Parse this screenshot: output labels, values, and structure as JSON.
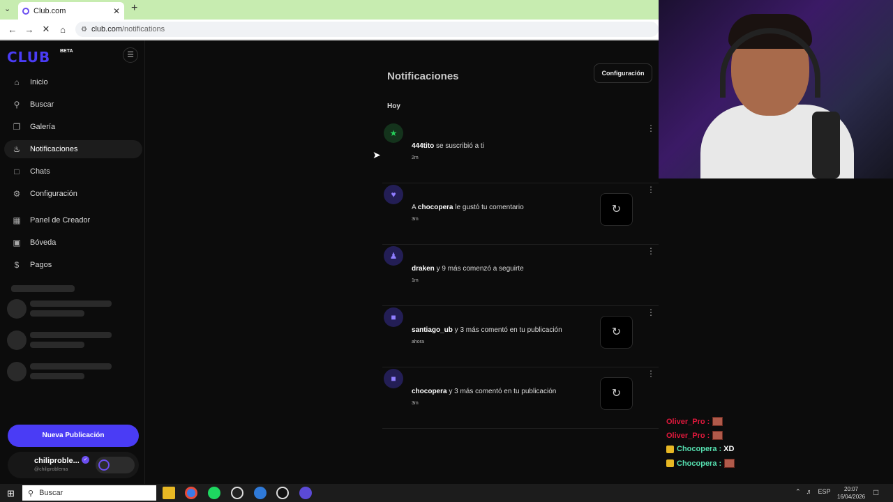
{
  "browser": {
    "tab_title": "Club.com",
    "url_host": "club.com",
    "url_path": "/notifications"
  },
  "sidebar": {
    "logo": "CLUB",
    "beta": "BETA",
    "items": [
      {
        "label": "Inicio",
        "icon": "home-icon"
      },
      {
        "label": "Buscar",
        "icon": "search-icon"
      },
      {
        "label": "Galería",
        "icon": "gallery-icon"
      },
      {
        "label": "Notificaciones",
        "icon": "bell-icon"
      },
      {
        "label": "Chats",
        "icon": "chat-icon"
      },
      {
        "label": "Configuración",
        "icon": "gear-icon"
      },
      {
        "label": "Panel de Creador",
        "icon": "dashboard-icon"
      },
      {
        "label": "Bóveda",
        "icon": "vault-icon"
      },
      {
        "label": "Pagos",
        "icon": "dollar-icon"
      }
    ],
    "new_post": "Nueva Publicación",
    "user_name": "chiliproble...",
    "user_handle": "@chiliproblema"
  },
  "main": {
    "title": "Notificaciones",
    "config_button": "Configuración",
    "section": "Hoy",
    "notifications": [
      {
        "user": "444tito",
        "pre": "",
        "rest": " se suscribió a ti",
        "time": "2m",
        "icon": "star-icon",
        "color": "green"
      },
      {
        "user": "chocopera",
        "pre": "A ",
        "rest": " le gustó tu comentario",
        "time": "3m",
        "icon": "heart-icon",
        "color": "purple"
      },
      {
        "user": "draken",
        "pre": "",
        "rest": " y 9 más comenzó a seguirte",
        "time": "1m",
        "icon": "person-add-icon",
        "color": "purple"
      },
      {
        "user": "santiago_ub",
        "pre": "",
        "rest": " y 3 más comentó en tu publicación",
        "time": "ahora",
        "icon": "comment-icon",
        "color": "purple"
      },
      {
        "user": "chocopera",
        "pre": "",
        "rest": " y 3 más comentó en tu publicación",
        "time": "3m",
        "icon": "comment-icon",
        "color": "purple"
      }
    ]
  },
  "stream_chat": [
    {
      "name": "Oliver_Pro",
      "sep": " :",
      "msg": "",
      "color": "#e0183c",
      "crown": false
    },
    {
      "name": "Oliver_Pro",
      "sep": " :",
      "msg": "",
      "color": "#e0183c",
      "crown": false
    },
    {
      "name": "Chocopera",
      "sep": " :",
      "msg": "XD",
      "color": "#56e0b0",
      "crown": true
    },
    {
      "name": "Chocopera",
      "sep": " :",
      "msg": "",
      "color": "#56e0b0",
      "crown": true
    }
  ],
  "taskbar": {
    "search": "Buscar",
    "lang": "ESP",
    "time": "20:07",
    "date": "16/04/2026"
  }
}
